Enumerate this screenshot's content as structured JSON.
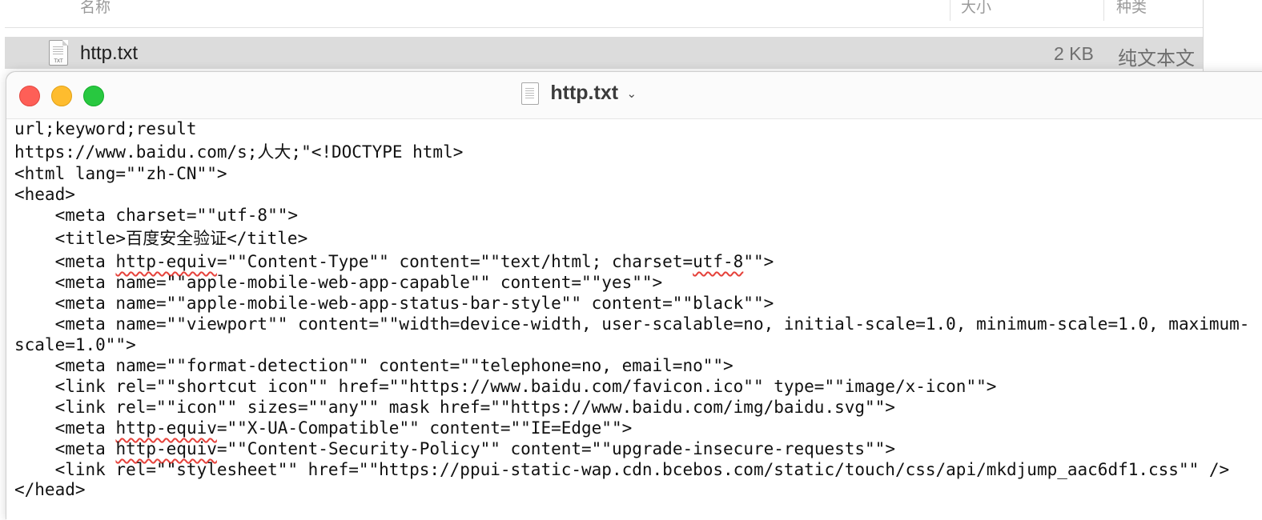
{
  "finder": {
    "columns": {
      "name": "名称",
      "size": "大小",
      "kind": "种类"
    },
    "row": {
      "name": "http.txt",
      "size": "2 KB",
      "kind": "纯文本文",
      "icon": "txt-file-icon",
      "icon_text": "TXT"
    }
  },
  "window": {
    "title": "http.txt",
    "title_icon": "document-icon",
    "chevron": "chevron-down-icon",
    "traffic_colors": {
      "close": "#fe5f57",
      "minimize": "#febc2e",
      "maximize": "#28c840"
    }
  },
  "document": {
    "lines": [
      {
        "text": "url;keyword;result"
      },
      {
        "text": "https://www.baidu.com/s;人大;\"<!DOCTYPE html>"
      },
      {
        "text": "<html lang=\"\"zh-CN\"\">"
      },
      {
        "text": "<head>"
      },
      {
        "text": "    <meta charset=\"\"utf-8\"\">"
      },
      {
        "text": "    <title>百度安全验证</title>"
      },
      {
        "parts": [
          "    <meta ",
          "http-equiv",
          "=\"\"Content-Type\"\" content=\"\"text/html; charset=",
          "utf-8",
          "\"\">"
        ]
      },
      {
        "text": "    <meta name=\"\"apple-mobile-web-app-capable\"\" content=\"\"yes\"\">"
      },
      {
        "text": "    <meta name=\"\"apple-mobile-web-app-status-bar-style\"\" content=\"\"black\"\">"
      },
      {
        "text": "    <meta name=\"\"viewport\"\" content=\"\"width=device-width, user-scalable=no, initial-scale=1.0, minimum-scale=1.0, maximum-"
      },
      {
        "text": "scale=1.0\"\">"
      },
      {
        "text": "    <meta name=\"\"format-detection\"\" content=\"\"telephone=no, email=no\"\">"
      },
      {
        "text": "    <link rel=\"\"shortcut icon\"\" href=\"\"https://www.baidu.com/favicon.ico\"\" type=\"\"image/x-icon\"\">"
      },
      {
        "text": "    <link rel=\"\"icon\"\" sizes=\"\"any\"\" mask href=\"\"https://www.baidu.com/img/baidu.svg\"\">"
      },
      {
        "parts": [
          "    <meta ",
          "http-equiv",
          "=\"\"X-UA-Compatible\"\" content=\"\"IE=Edge\"\">"
        ]
      },
      {
        "parts": [
          "    <meta ",
          "http-equiv",
          "=\"\"Content-Security-Policy\"\" content=\"\"upgrade-insecure-requests\"\">"
        ]
      },
      {
        "text": "    <link rel=\"\"stylesheet\"\" href=\"\"https://ppui-static-wap.cdn.bcebos.com/static/touch/css/api/mkdjump_aac6df1.css\"\" />"
      },
      {
        "text": "</head>"
      }
    ]
  }
}
